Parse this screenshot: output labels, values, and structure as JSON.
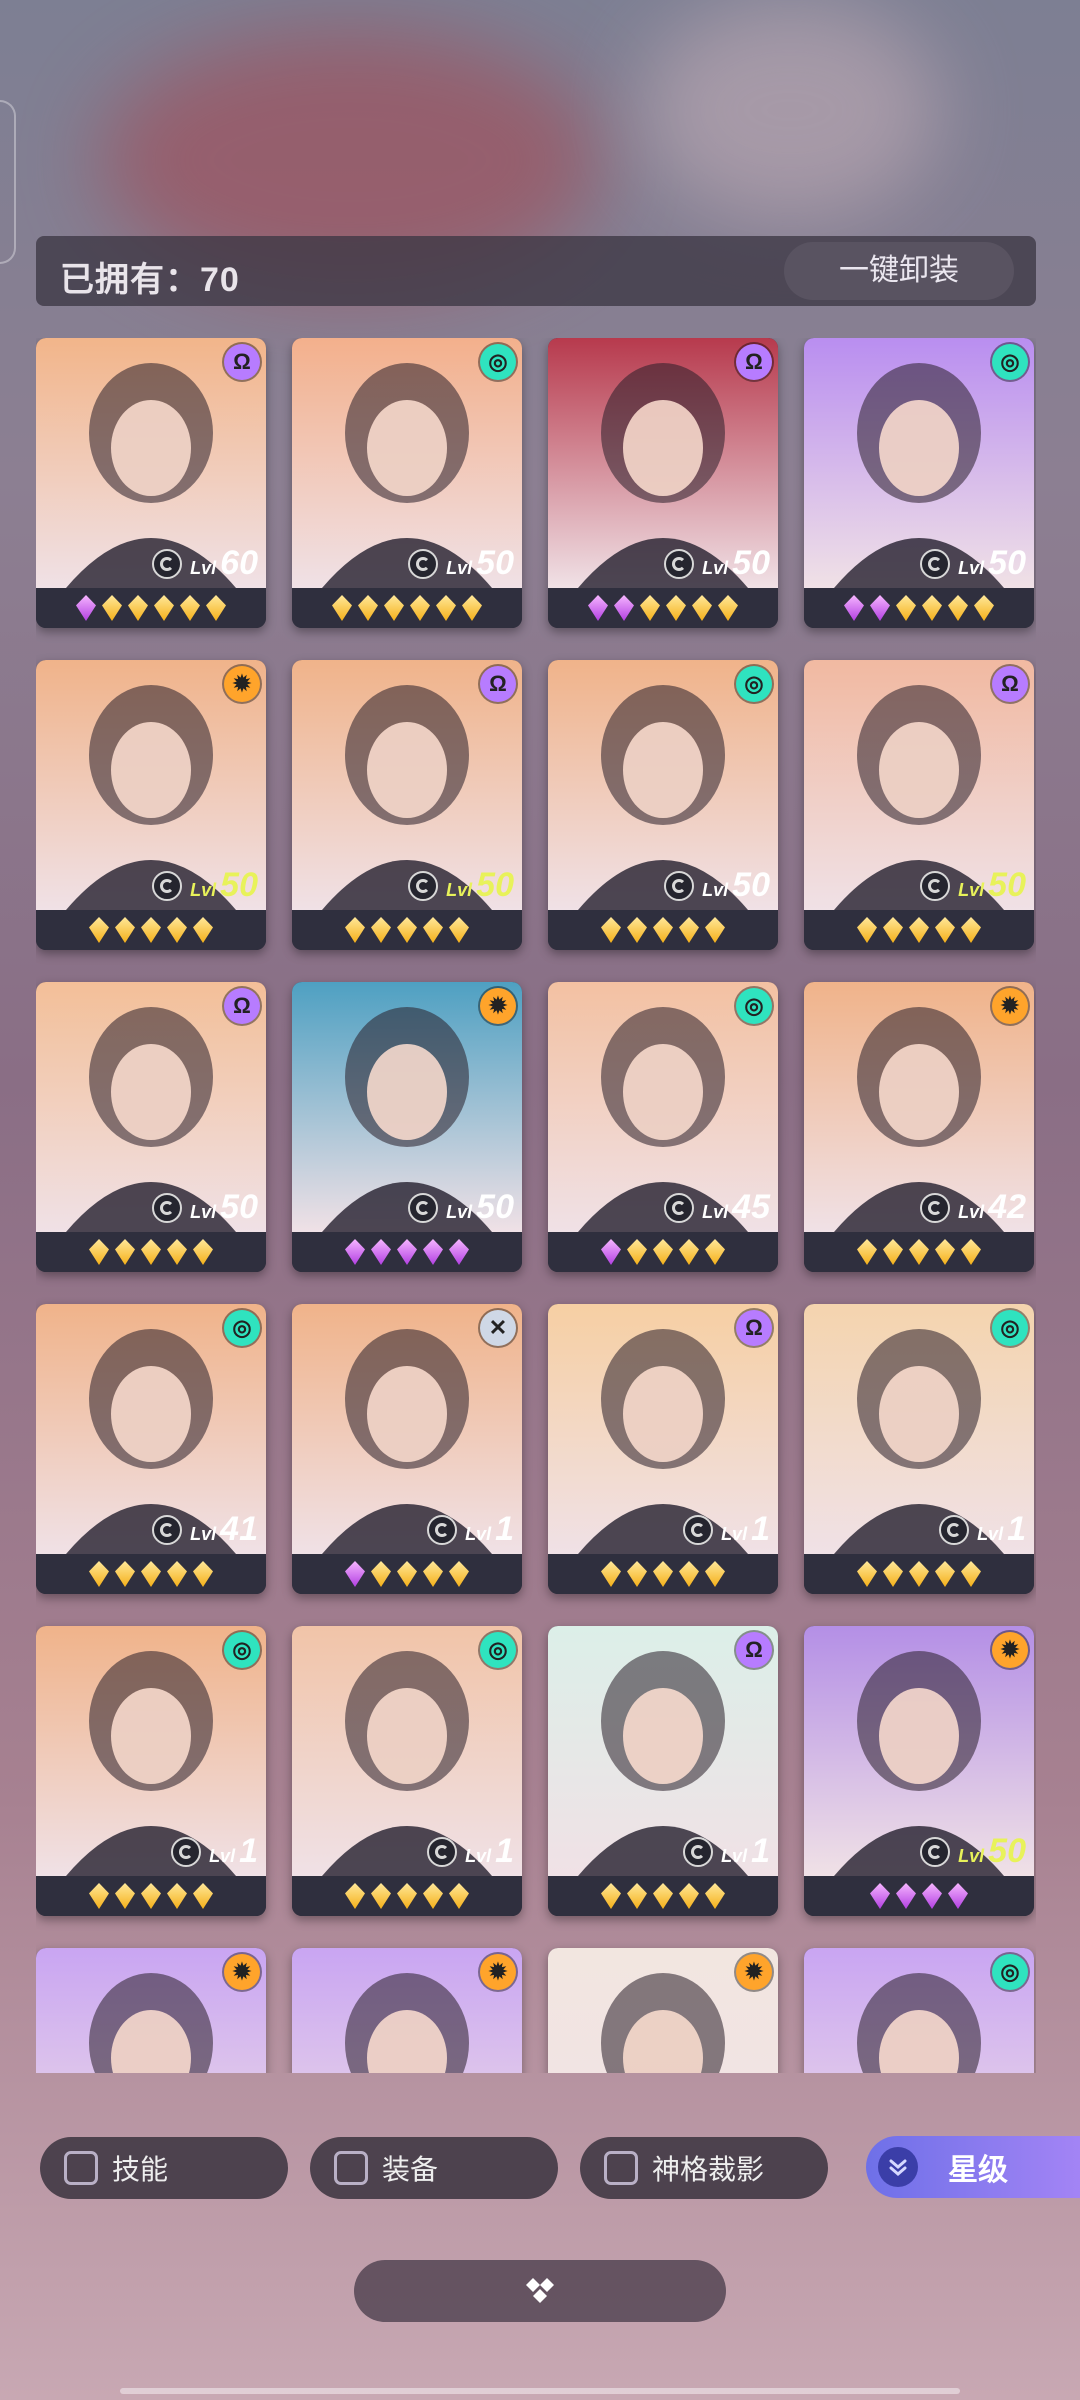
{
  "header": {
    "owned_label": "已拥有：70",
    "unequip_label": "一键卸装"
  },
  "colors": {
    "lvl_white": "#ffffff",
    "lvl_yellow": "#e8f25a",
    "class_purple": "#b77cff",
    "class_teal": "#2fe3bf",
    "class_orange": "#ffa42b",
    "class_silver": "#cfd8e6"
  },
  "heroes": [
    {
      "lvl_prefix": "Lvl",
      "level": "60",
      "class": "purple",
      "stars": [
        "purple",
        "gold",
        "gold",
        "gold",
        "gold",
        "gold"
      ],
      "bg": "#f2b58a",
      "lvl_color": "white"
    },
    {
      "lvl_prefix": "Lvl",
      "level": "50",
      "class": "teal",
      "stars": [
        "gold",
        "gold",
        "gold",
        "gold",
        "gold",
        "gold"
      ],
      "bg": "#f3b08c",
      "lvl_color": "white"
    },
    {
      "lvl_prefix": "Lvl",
      "level": "50",
      "class": "purple",
      "stars": [
        "purple",
        "purple",
        "gold",
        "gold",
        "gold",
        "gold"
      ],
      "bg": "#b73a4d",
      "lvl_color": "white"
    },
    {
      "lvl_prefix": "Lvl",
      "level": "50",
      "class": "teal",
      "stars": [
        "purple",
        "purple",
        "gold",
        "gold",
        "gold",
        "gold"
      ],
      "bg": "#b98ef0",
      "lvl_color": "white"
    },
    {
      "lvl_prefix": "Lvl",
      "level": "50",
      "class": "orange",
      "stars": [
        "gold",
        "gold",
        "gold",
        "gold",
        "gold"
      ],
      "bg": "#f0b38a",
      "lvl_color": "yellow"
    },
    {
      "lvl_prefix": "Lvl",
      "level": "50",
      "class": "purple",
      "stars": [
        "gold",
        "gold",
        "gold",
        "gold",
        "gold"
      ],
      "bg": "#f0b38a",
      "lvl_color": "yellow"
    },
    {
      "lvl_prefix": "Lvl",
      "level": "50",
      "class": "teal",
      "stars": [
        "gold",
        "gold",
        "gold",
        "gold",
        "gold"
      ],
      "bg": "#f0b38a",
      "lvl_color": "white"
    },
    {
      "lvl_prefix": "Lvl",
      "level": "50",
      "class": "purple",
      "stars": [
        "gold",
        "gold",
        "gold",
        "gold",
        "gold"
      ],
      "bg": "#f1b9a1",
      "lvl_color": "yellow"
    },
    {
      "lvl_prefix": "Lvl",
      "level": "50",
      "class": "purple",
      "stars": [
        "gold",
        "gold",
        "gold",
        "gold",
        "gold"
      ],
      "bg": "#f3bf98",
      "lvl_color": "white"
    },
    {
      "lvl_prefix": "Lvl",
      "level": "50",
      "class": "orange",
      "stars": [
        "purple",
        "purple",
        "purple",
        "purple",
        "purple"
      ],
      "bg": "#4ea0c2",
      "lvl_color": "white"
    },
    {
      "lvl_prefix": "Lvl",
      "level": "45",
      "class": "teal",
      "stars": [
        "purple",
        "gold",
        "gold",
        "gold",
        "gold"
      ],
      "bg": "#f3c1a2",
      "lvl_color": "white"
    },
    {
      "lvl_prefix": "Lvl",
      "level": "42",
      "class": "orange",
      "stars": [
        "gold",
        "gold",
        "gold",
        "gold",
        "gold"
      ],
      "bg": "#f0b38a",
      "lvl_color": "white"
    },
    {
      "lvl_prefix": "Lvl",
      "level": "41",
      "class": "teal",
      "stars": [
        "gold",
        "gold",
        "gold",
        "gold",
        "gold"
      ],
      "bg": "#f0b38a",
      "lvl_color": "white"
    },
    {
      "lvl_prefix": "Lvl",
      "level": "1",
      "class": "silver",
      "stars": [
        "purple",
        "gold",
        "gold",
        "gold",
        "gold"
      ],
      "bg": "#f0b38a",
      "lvl_color": "white"
    },
    {
      "lvl_prefix": "Lvl",
      "level": "1",
      "class": "purple",
      "stars": [
        "gold",
        "gold",
        "gold",
        "gold",
        "gold"
      ],
      "bg": "#f6cfa3",
      "lvl_color": "white"
    },
    {
      "lvl_prefix": "Lvl",
      "level": "1",
      "class": "teal",
      "stars": [
        "gold",
        "gold",
        "gold",
        "gold",
        "gold"
      ],
      "bg": "#f4d4ae",
      "lvl_color": "white"
    },
    {
      "lvl_prefix": "Lvl",
      "level": "1",
      "class": "teal",
      "stars": [
        "gold",
        "gold",
        "gold",
        "gold",
        "gold"
      ],
      "bg": "#f0b38a",
      "lvl_color": "white"
    },
    {
      "lvl_prefix": "Lvl",
      "level": "1",
      "class": "teal",
      "stars": [
        "gold",
        "gold",
        "gold",
        "gold",
        "gold"
      ],
      "bg": "#f1c4a8",
      "lvl_color": "white"
    },
    {
      "lvl_prefix": "Lvl",
      "level": "1",
      "class": "purple",
      "stars": [
        "gold",
        "gold",
        "gold",
        "gold",
        "gold"
      ],
      "bg": "#dcefe8",
      "lvl_color": "white"
    },
    {
      "lvl_prefix": "Lvl",
      "level": "50",
      "class": "orange",
      "stars": [
        "purple",
        "purple",
        "purple",
        "purple"
      ],
      "bg": "#b48fe6",
      "lvl_color": "yellow"
    },
    {
      "class": "orange",
      "bg": "#c9a5f2"
    },
    {
      "class": "orange",
      "bg": "#c9a5f2"
    },
    {
      "class": "orange",
      "bg": "#f2e6e0"
    },
    {
      "class": "teal",
      "bg": "#c9a5f2"
    }
  ],
  "filters": [
    {
      "label": "技能",
      "name": "filter-skill"
    },
    {
      "label": "装备",
      "name": "filter-equipment"
    },
    {
      "label": "神格裁影",
      "name": "filter-divinity"
    }
  ],
  "sort_button": {
    "label": "星级",
    "icon": "chevron-double-down-icon"
  },
  "collapse_handle": {
    "icon": "diamond-cluster-icon"
  }
}
